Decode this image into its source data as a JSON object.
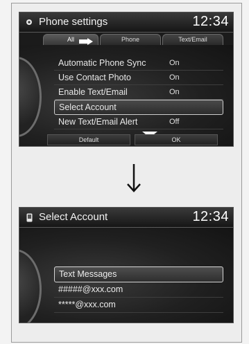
{
  "top_screen": {
    "title": "Phone settings",
    "clock": "12:34",
    "tabs": [
      {
        "label": "All"
      },
      {
        "label": "Phone"
      },
      {
        "label": "Text/Email"
      }
    ],
    "rows": [
      {
        "label": "Automatic Phone Sync",
        "value": "On"
      },
      {
        "label": "Use Contact Photo",
        "value": "On"
      },
      {
        "label": "Enable Text/Email",
        "value": "On"
      },
      {
        "label": "Select Account",
        "value": ""
      },
      {
        "label": "New Text/Email Alert",
        "value": "Off"
      }
    ],
    "buttons": {
      "default": "Default",
      "ok": "OK"
    }
  },
  "bottom_screen": {
    "title": "Select Account",
    "clock": "12:34",
    "rows": [
      {
        "label": "Text Messages"
      },
      {
        "label": "#####@xxx.com"
      },
      {
        "label": "*****@xxx.com"
      }
    ]
  },
  "colors": {
    "screen_bg": "#1b1b1b",
    "selection_border": "#cfcfcf",
    "text": "#e8e8e8"
  },
  "icons": [
    "settings-icon",
    "right-arrow-icon",
    "down-triangle-icon",
    "down-arrow-icon",
    "phone-icon"
  ]
}
